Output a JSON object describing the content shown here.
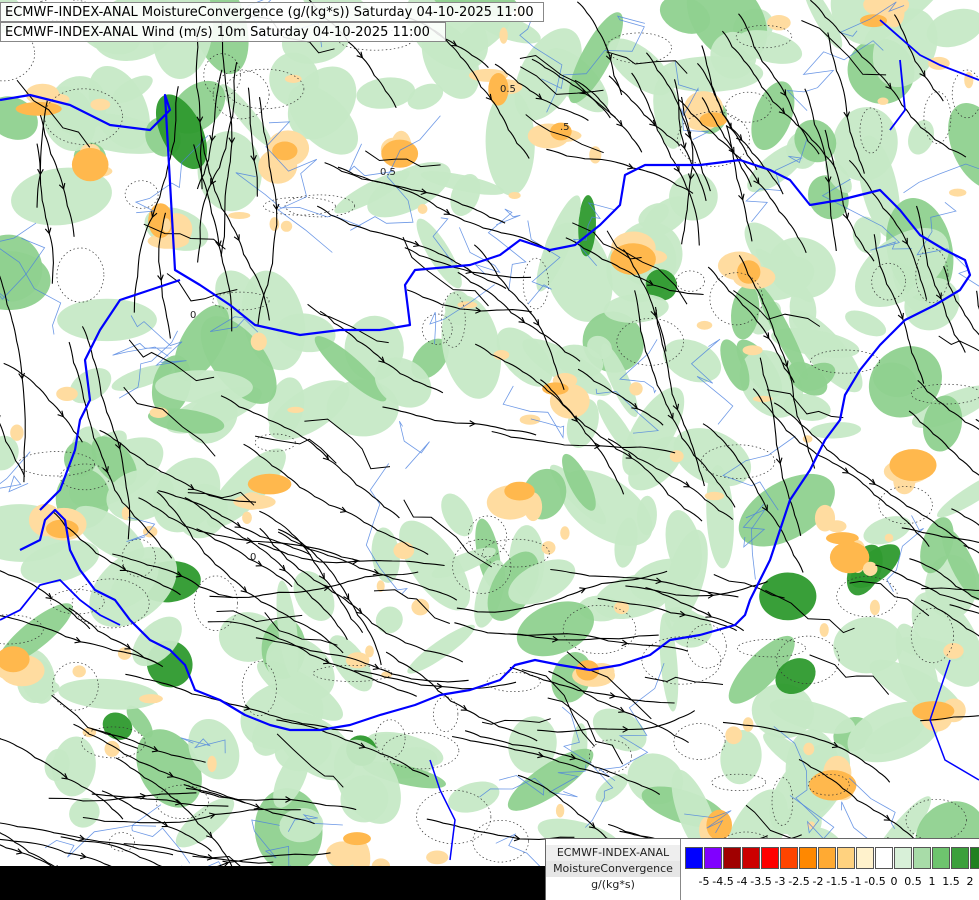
{
  "header": {
    "line1": "ECMWF-INDEX-ANAL MoistureConvergence (g/(kg*s)) Saturday 04-10-2025 11:00",
    "line2": "ECMWF-INDEX-ANAL Wind (m/s) 10m Saturday 04-10-2025 11:00"
  },
  "legend": {
    "model": "ECMWF-INDEX-ANAL",
    "parameter": "MoistureConvergence",
    "units": "g/(kg*s)",
    "swatch_colors": [
      "#0000ff",
      "#8000ff",
      "#a00000",
      "#cc0000",
      "#ff0000",
      "#ff4400",
      "#ff8800",
      "#ffaa33",
      "#ffd27f",
      "#fff2cc",
      "#ffffff",
      "#d8f0d8",
      "#a8dca8",
      "#6ec46e",
      "#3ca03c",
      "#208020",
      "#00a000"
    ],
    "tick_labels": [
      "-5",
      "-4.5",
      "-4",
      "-3.5",
      "-3",
      "-2.5",
      "-2",
      "-1.5",
      "-1",
      "-0.5",
      "0",
      "0.5",
      "1",
      "1.5",
      "2"
    ]
  },
  "contour_labels": [
    "0",
    "0.5",
    ".5",
    "0.5",
    "0"
  ],
  "colors": {
    "border": "#0000ff",
    "river": "#4a7fe0",
    "streamline": "#000000",
    "convergence_light": "#c6e9c6",
    "convergence_mid": "#8fd18f",
    "convergence_strong": "#2e9a2e",
    "divergence_light": "#ffdca0",
    "divergence_mid": "#ffb84d",
    "background": "#ffffff"
  }
}
